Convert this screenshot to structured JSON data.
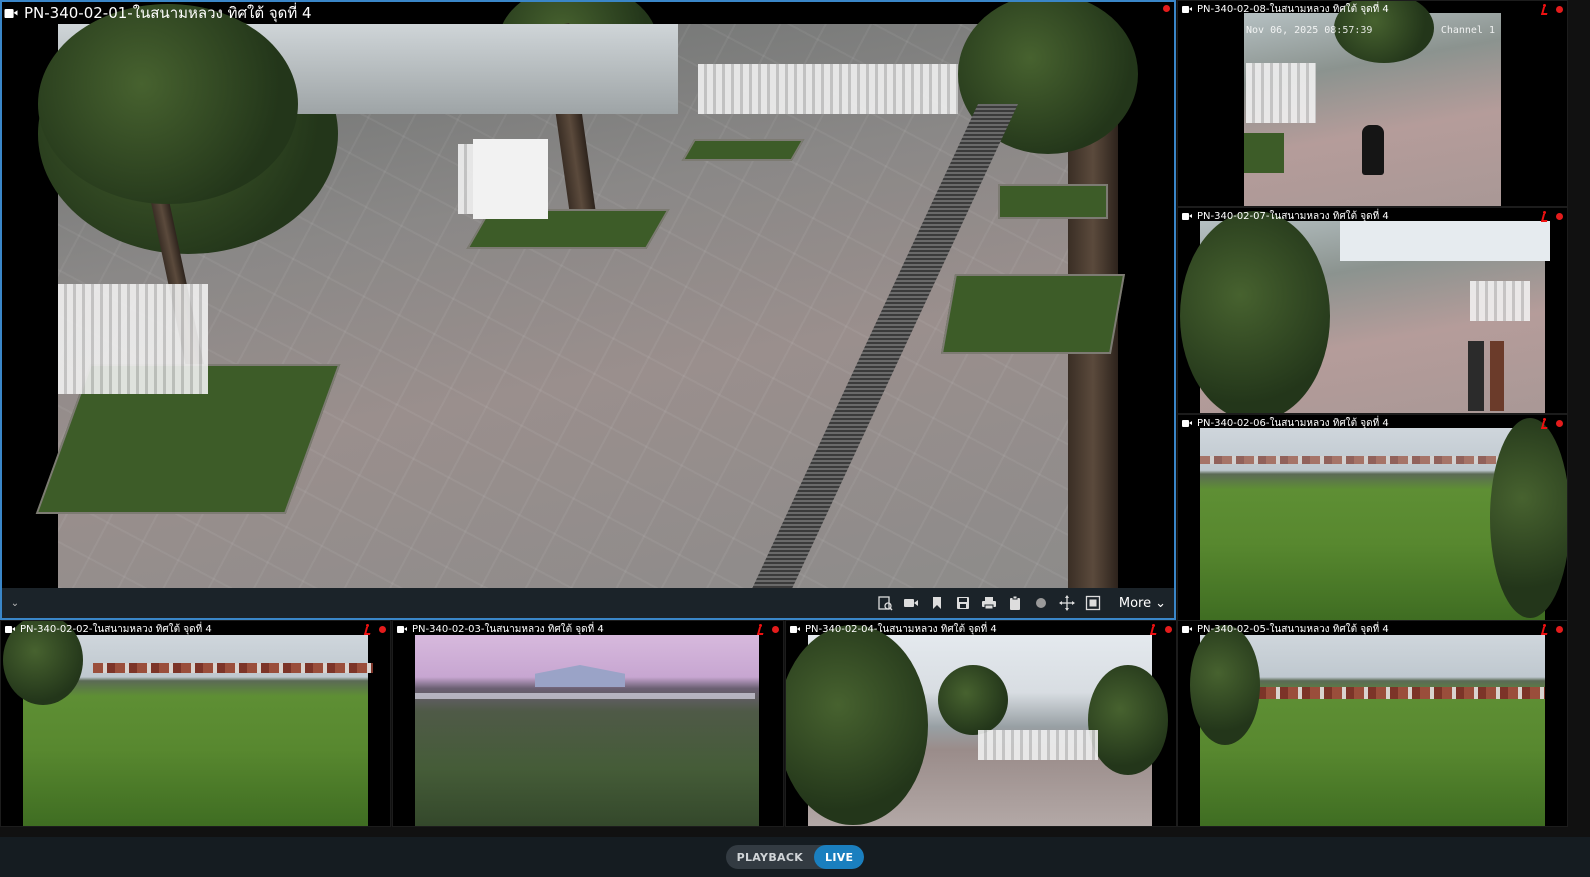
{
  "main_camera": {
    "title": "PN-340-02-01-ในสนามหลวง ทิศใต้ จุดที่ 4",
    "toolbar": {
      "more_label": "More",
      "tools": [
        "search-playback-icon",
        "record-icon",
        "bookmark-icon",
        "save-icon",
        "print-icon",
        "clipboard-icon",
        "circle-icon",
        "move-icon",
        "fullscreen-icon"
      ]
    }
  },
  "cameras": [
    {
      "title": "PN-340-02-08-ในสนามหลวง ทิศใต้ จุดที่ 4",
      "osd_time": "Nov 06, 2025 08:57:39",
      "osd_channel": "Channel 1"
    },
    {
      "title": "PN-340-02-07-ในสนามหลวง ทิศใต้ จุดที่ 4"
    },
    {
      "title": "PN-340-02-06-ในสนามหลวง ทิศใต้ จุดที่ 4"
    },
    {
      "title": "PN-340-02-02-ในสนามหลวง ทิศใต้ จุดที่ 4"
    },
    {
      "title": "PN-340-02-03-ในสนามหลวง ทิศใต้ จุดที่ 4"
    },
    {
      "title": "PN-340-02-04-ในสนามหลวง ทิศใต้ จุดที่ 4"
    },
    {
      "title": "PN-340-02-05-ในสนามหลวง ทิศใต้ จุดที่ 4"
    }
  ],
  "mode_switch": {
    "playback_label": "PLAYBACK",
    "live_label": "LIVE",
    "active": "LIVE"
  },
  "colors": {
    "selected_border": "#3a86c8",
    "recording": "#e41c1c",
    "live_accent": "#1a7fbf"
  }
}
